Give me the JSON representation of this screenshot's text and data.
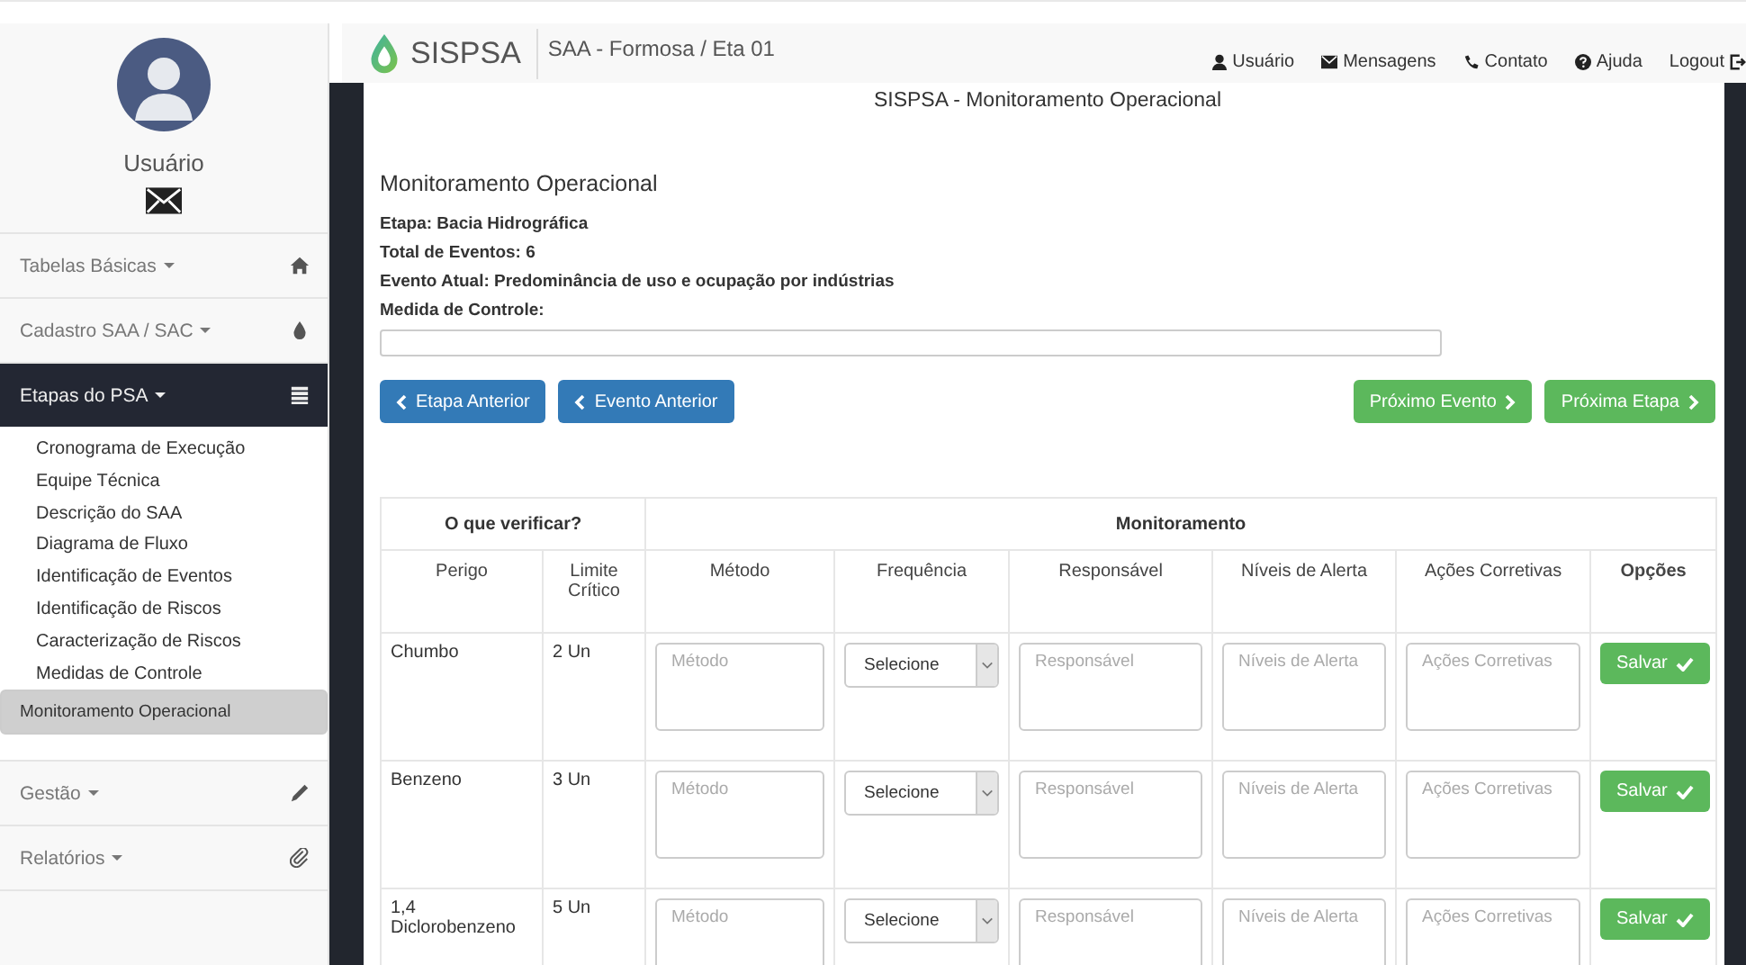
{
  "sidebar": {
    "user": "Usuário",
    "menu": [
      {
        "label": "Tabelas Básicas",
        "kind": "home",
        "expanded": false
      },
      {
        "label": "Cadastro SAA / SAC",
        "kind": "drop",
        "expanded": false
      },
      {
        "label": "Etapas do PSA",
        "kind": "list",
        "expanded": true,
        "children": [
          {
            "label": "Cronograma de Execução",
            "selected": false
          },
          {
            "label": "Equipe Técnica",
            "selected": false
          },
          {
            "label": "Descrição do SAA",
            "selected": false
          },
          {
            "label": "Diagrama de Fluxo",
            "selected": false
          },
          {
            "label": "Identificação de Eventos",
            "selected": false
          },
          {
            "label": "Identificação de Riscos",
            "selected": false
          },
          {
            "label": "Caracterização de Riscos",
            "selected": false
          },
          {
            "label": "Medidas de Controle",
            "selected": false
          },
          {
            "label": "Monitoramento Operacional",
            "selected": true
          }
        ]
      },
      {
        "label": "Gestão",
        "kind": "pencil",
        "expanded": false
      },
      {
        "label": "Relatórios",
        "kind": "clip",
        "expanded": false
      }
    ]
  },
  "header": {
    "brand": "SISPSA",
    "location": "SAA - Formosa / Eta 01",
    "nav": [
      {
        "label": "Usuário",
        "kind": "user"
      },
      {
        "label": "Mensagens",
        "kind": "mail"
      },
      {
        "label": "Contato",
        "kind": "phone"
      },
      {
        "label": "Ajuda",
        "kind": "help"
      },
      {
        "label": "Logout",
        "kind": "logout"
      }
    ]
  },
  "page_title": "SISPSA - Monitoramento Operacional",
  "panel": {
    "heading": "Monitoramento Operacional",
    "info": [
      "Etapa: Bacia Hidrográfica",
      "Total de Eventos: 6",
      "Evento Atual: Predominância de uso e ocupação por indústrias"
    ],
    "field_label": "Medida de Controle:",
    "buttons": [
      {
        "label": "Etapa Anterior",
        "kind": "back"
      },
      {
        "label": "Evento Anterior",
        "kind": "back"
      },
      {
        "label": "Próximo Evento",
        "kind": "next"
      },
      {
        "label": "Próxima Etapa",
        "kind": "next"
      }
    ]
  },
  "table": {
    "groups": [
      "O que verificar?",
      "Monitoramento"
    ],
    "columns": [
      "Perigo",
      "Limite Crítico",
      "Método",
      "Frequência",
      "Responsável",
      "Níveis de Alerta",
      "Ações Corretivas",
      "Opções"
    ],
    "rows": [
      {
        "perigo": "Chumbo",
        "limite": "2 Un",
        "fields": [
          {
            "kind": "textarea",
            "placeholder": "Método"
          },
          {
            "kind": "select",
            "value": "Selecione"
          },
          {
            "kind": "textarea",
            "placeholder": "Responsável"
          },
          {
            "kind": "textarea",
            "placeholder": "Níveis de Alerta"
          },
          {
            "kind": "textarea",
            "placeholder": "Ações Corretivas"
          }
        ],
        "action": "Salvar"
      },
      {
        "perigo": "Benzeno",
        "limite": "3 Un",
        "fields": [
          {
            "kind": "textarea",
            "placeholder": "Método"
          },
          {
            "kind": "select",
            "value": "Selecione"
          },
          {
            "kind": "textarea",
            "placeholder": "Responsável"
          },
          {
            "kind": "textarea",
            "placeholder": "Níveis de Alerta"
          },
          {
            "kind": "textarea",
            "placeholder": "Ações Corretivas"
          }
        ],
        "action": "Salvar"
      },
      {
        "perigo": "1,4 Diclorobenzeno",
        "limite": "5 Un",
        "fields": [
          {
            "kind": "textarea",
            "placeholder": "Método"
          },
          {
            "kind": "select",
            "value": "Selecione"
          },
          {
            "kind": "textarea",
            "placeholder": "Responsável"
          },
          {
            "kind": "textarea",
            "placeholder": "Níveis de Alerta"
          },
          {
            "kind": "textarea",
            "placeholder": "Ações Corretivas"
          }
        ],
        "action": "Salvar"
      }
    ]
  }
}
